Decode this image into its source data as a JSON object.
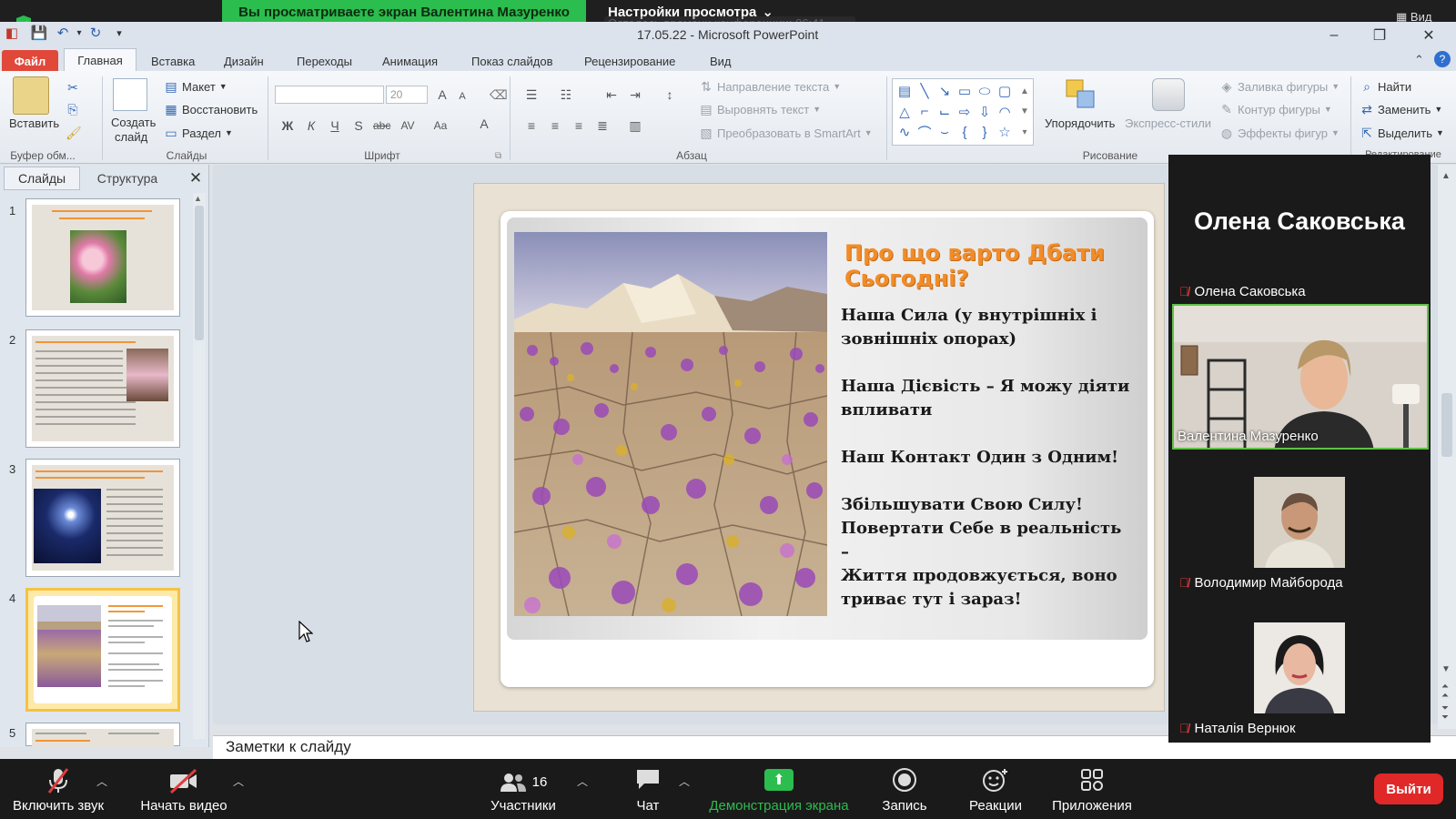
{
  "zoom": {
    "share_banner": "Вы просматриваете экран Валентина Мазуренко",
    "view_settings": "Настройки просмотра",
    "recording_ghost": "Осталось времени конференции: 06:41",
    "view_label": "Вид",
    "toolbar": {
      "unmute": "Включить звук",
      "start_video": "Начать видео",
      "participants": "Участники",
      "participants_count": "16",
      "chat": "Чат",
      "share_screen": "Демонстрация экрана",
      "record": "Запись",
      "reactions": "Реакции",
      "apps": "Приложения",
      "leave": "Выйти"
    },
    "panel": {
      "active_speaker": "Олена Саковська",
      "participants": [
        {
          "name": "Олена Саковська"
        },
        {
          "name": "Валентина Мазуренко"
        },
        {
          "name": "Володимир Майборода"
        },
        {
          "name": "Наталія Вернюк"
        }
      ]
    }
  },
  "powerpoint": {
    "title": "17.05.22 - Microsoft PowerPoint",
    "tabs": [
      "Файл",
      "Главная",
      "Вставка",
      "Дизайн",
      "Переходы",
      "Анимация",
      "Показ слайдов",
      "Рецензирование",
      "Вид"
    ],
    "ribbon": {
      "paste": "Вставить",
      "new_slide_1": "Создать",
      "new_slide_2": "слайд",
      "layout": "Макет",
      "reset": "Восстановить",
      "section": "Раздел",
      "font_size": "20",
      "text_direction": "Направление текста",
      "align_text": "Выровнять текст",
      "convert_smartart": "Преобразовать в SmartArt",
      "arrange": "Упорядочить",
      "quick_styles": "Экспресс-стили",
      "shape_fill": "Заливка фигуры",
      "shape_outline": "Контур фигуры",
      "shape_effects": "Эффекты фигур",
      "find": "Найти",
      "replace": "Заменить",
      "select": "Выделить",
      "groups": {
        "clipboard": "Буфер обм...",
        "slides": "Слайды",
        "font": "Шрифт",
        "paragraph": "Абзац",
        "drawing": "Рисование",
        "editing": "Редактирование"
      }
    },
    "panel_tabs": {
      "slides": "Слайды",
      "structure": "Структура"
    },
    "slide_numbers": [
      "1",
      "2",
      "3",
      "4",
      "5"
    ],
    "slide": {
      "title": "Про що варто Дбати Сьогодні?",
      "lines": [
        "Наша Сила (у внутрішніх і зовнішніх опорах)",
        "Наша Дієвість – Я можу діяти впливати",
        "Наш Контакт Один з Одним!",
        "Збільшувати Свою Силу! Повертати Себе в реальність –",
        "Життя продовжується, воно триває тут і зараз!"
      ]
    },
    "notes_placeholder": "Заметки к слайду"
  }
}
